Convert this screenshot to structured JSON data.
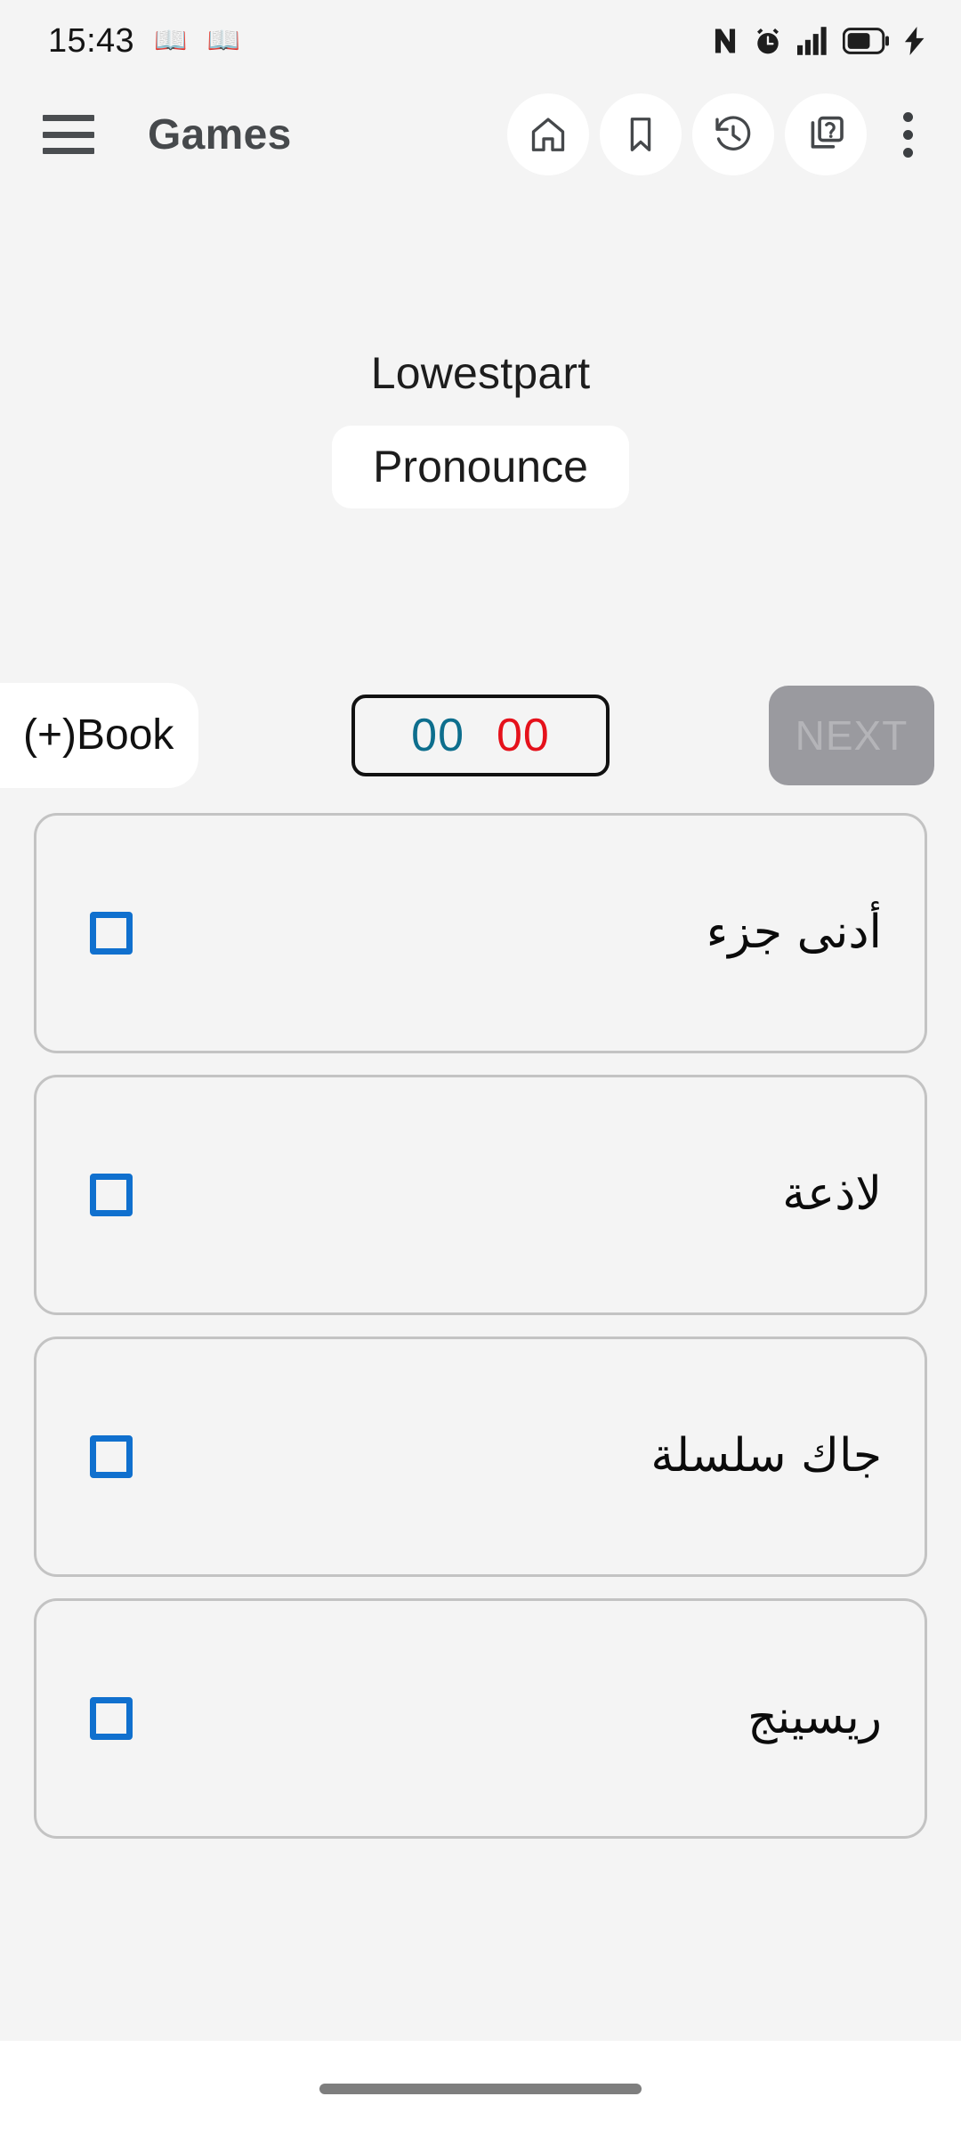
{
  "statusbar": {
    "time": "15:43",
    "book_glyph_1": "📖",
    "book_glyph_2": "📖",
    "icons": [
      "nfc-icon",
      "alarm-icon",
      "signal-icon",
      "battery-icon",
      "charging-bolt-icon"
    ],
    "battery_level_percent": 70
  },
  "appbar": {
    "menu_label": "menu",
    "title": "Games",
    "actions": [
      {
        "name": "home",
        "icon": "home-icon"
      },
      {
        "name": "bookmark",
        "icon": "bookmark-icon"
      },
      {
        "name": "history",
        "icon": "history-icon"
      },
      {
        "name": "quiz",
        "icon": "quiz-cards-icon"
      }
    ],
    "overflow_label": "more options"
  },
  "question": {
    "prompt_word": "Lowestpart",
    "pronounce_label": "Pronounce"
  },
  "controls": {
    "book_label": "(+)Book",
    "score_correct": "00",
    "score_wrong": "00",
    "next_label": "NEXT",
    "next_enabled": false
  },
  "answers": [
    {
      "text": "أدنى جزء",
      "checked": false
    },
    {
      "text": "لاذعة",
      "checked": false
    },
    {
      "text": "جاك سلسلة",
      "checked": false
    },
    {
      "text": "ريسينج",
      "checked": false
    }
  ],
  "colors": {
    "page_background": "#f4f4f4",
    "score_correct": "#0d6e8d",
    "score_wrong": "#e5111b",
    "checkbox_blue": "#1070ce",
    "next_disabled_bg": "#9a9a9f",
    "card_border": "#c3c3c3",
    "title_grey": "#46494c"
  }
}
